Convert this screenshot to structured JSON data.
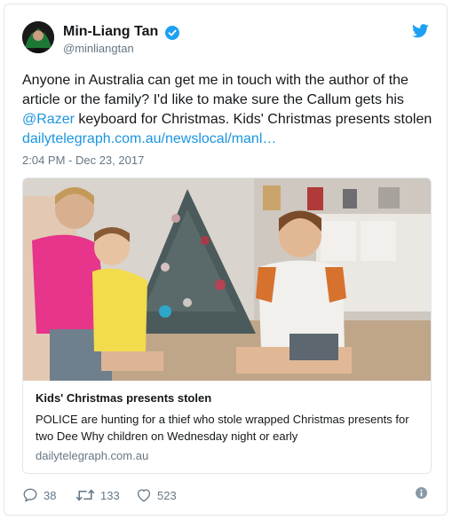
{
  "author": {
    "display_name": "Min-Liang Tan",
    "handle": "@minliangtan",
    "verified": true
  },
  "tweet": {
    "text_part1": "Anyone in Australia can get me in touch with the author of the article or the family? I'd like to make sure the Callum gets his ",
    "mention": "@Razer",
    "text_part2": " keyboard for Christmas. Kids' Christmas presents stolen ",
    "link": "dailytelegraph.com.au/newslocal/manl…",
    "timestamp": "2:04 PM - Dec 23, 2017"
  },
  "card": {
    "title": "Kids' Christmas presents stolen",
    "description": "POLICE are hunting for a thief who stole wrapped Christmas presents for two Dee Why children on Wednesday night or early",
    "domain": "dailytelegraph.com.au"
  },
  "actions": {
    "reply_count": "38",
    "retweet_count": "133",
    "like_count": "523"
  },
  "icons": {
    "verified": "verified-badge-icon",
    "brand": "twitter-bird-icon",
    "reply": "reply-icon",
    "retweet": "retweet-icon",
    "like": "heart-icon",
    "info": "info-icon"
  },
  "colors": {
    "link": "#1b95e0",
    "verified": "#1da1f2",
    "muted_text": "#657786",
    "border": "#e1e8ed"
  }
}
